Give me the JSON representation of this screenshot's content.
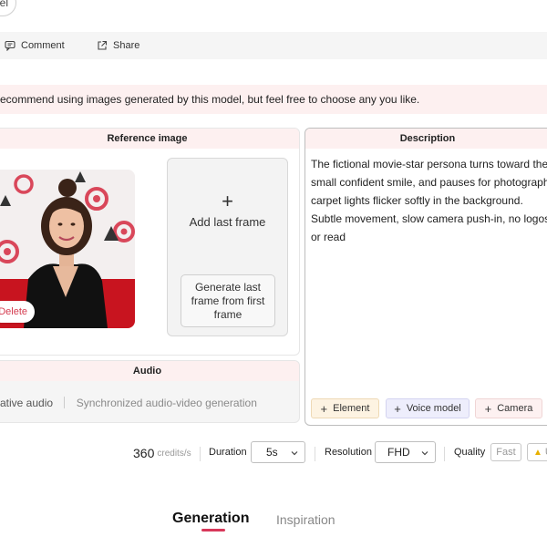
{
  "top_pill": {
    "label": "el"
  },
  "toolbar": {
    "comment_label": "Comment",
    "share_label": "Share"
  },
  "banner": {
    "text": "ecommend using images generated by this model, but feel free to choose any you like."
  },
  "reference": {
    "header": "Reference image",
    "delete_label": "Delete",
    "add_last_plus": "+",
    "add_last_label": "Add last frame",
    "generate_label": "Generate last frame from first frame"
  },
  "audio": {
    "header": "Audio",
    "option_label": "ative audio",
    "option_desc": "Synchronized audio-video generation"
  },
  "description": {
    "header": "Description",
    "text": "The fictional movie-star persona turns toward the c small confident smile, and pauses for photographe carpet lights flicker softly in the background. Subtle movement, slow camera push-in, no logos or read",
    "chips": {
      "element": "Element",
      "voice_model": "Voice model",
      "camera": "Camera"
    }
  },
  "settings": {
    "credits_value": "360",
    "credits_unit": "credits/s",
    "duration_label": "Duration",
    "duration_value": "5s",
    "resolution_label": "Resolution",
    "resolution_value": "FHD",
    "quality_label": "Quality",
    "quality_fast": "Fast",
    "quality_next_partial": "U"
  },
  "tabs": {
    "generation": "Generation",
    "inspiration": "Inspiration"
  },
  "colors": {
    "accent": "#d8385a",
    "panel_header_bg": "#fdf0f0",
    "element_chip_bg": "#fdf3e2",
    "voice_chip_bg": "#eeeefc",
    "camera_chip_bg": "#fdf1f1"
  }
}
